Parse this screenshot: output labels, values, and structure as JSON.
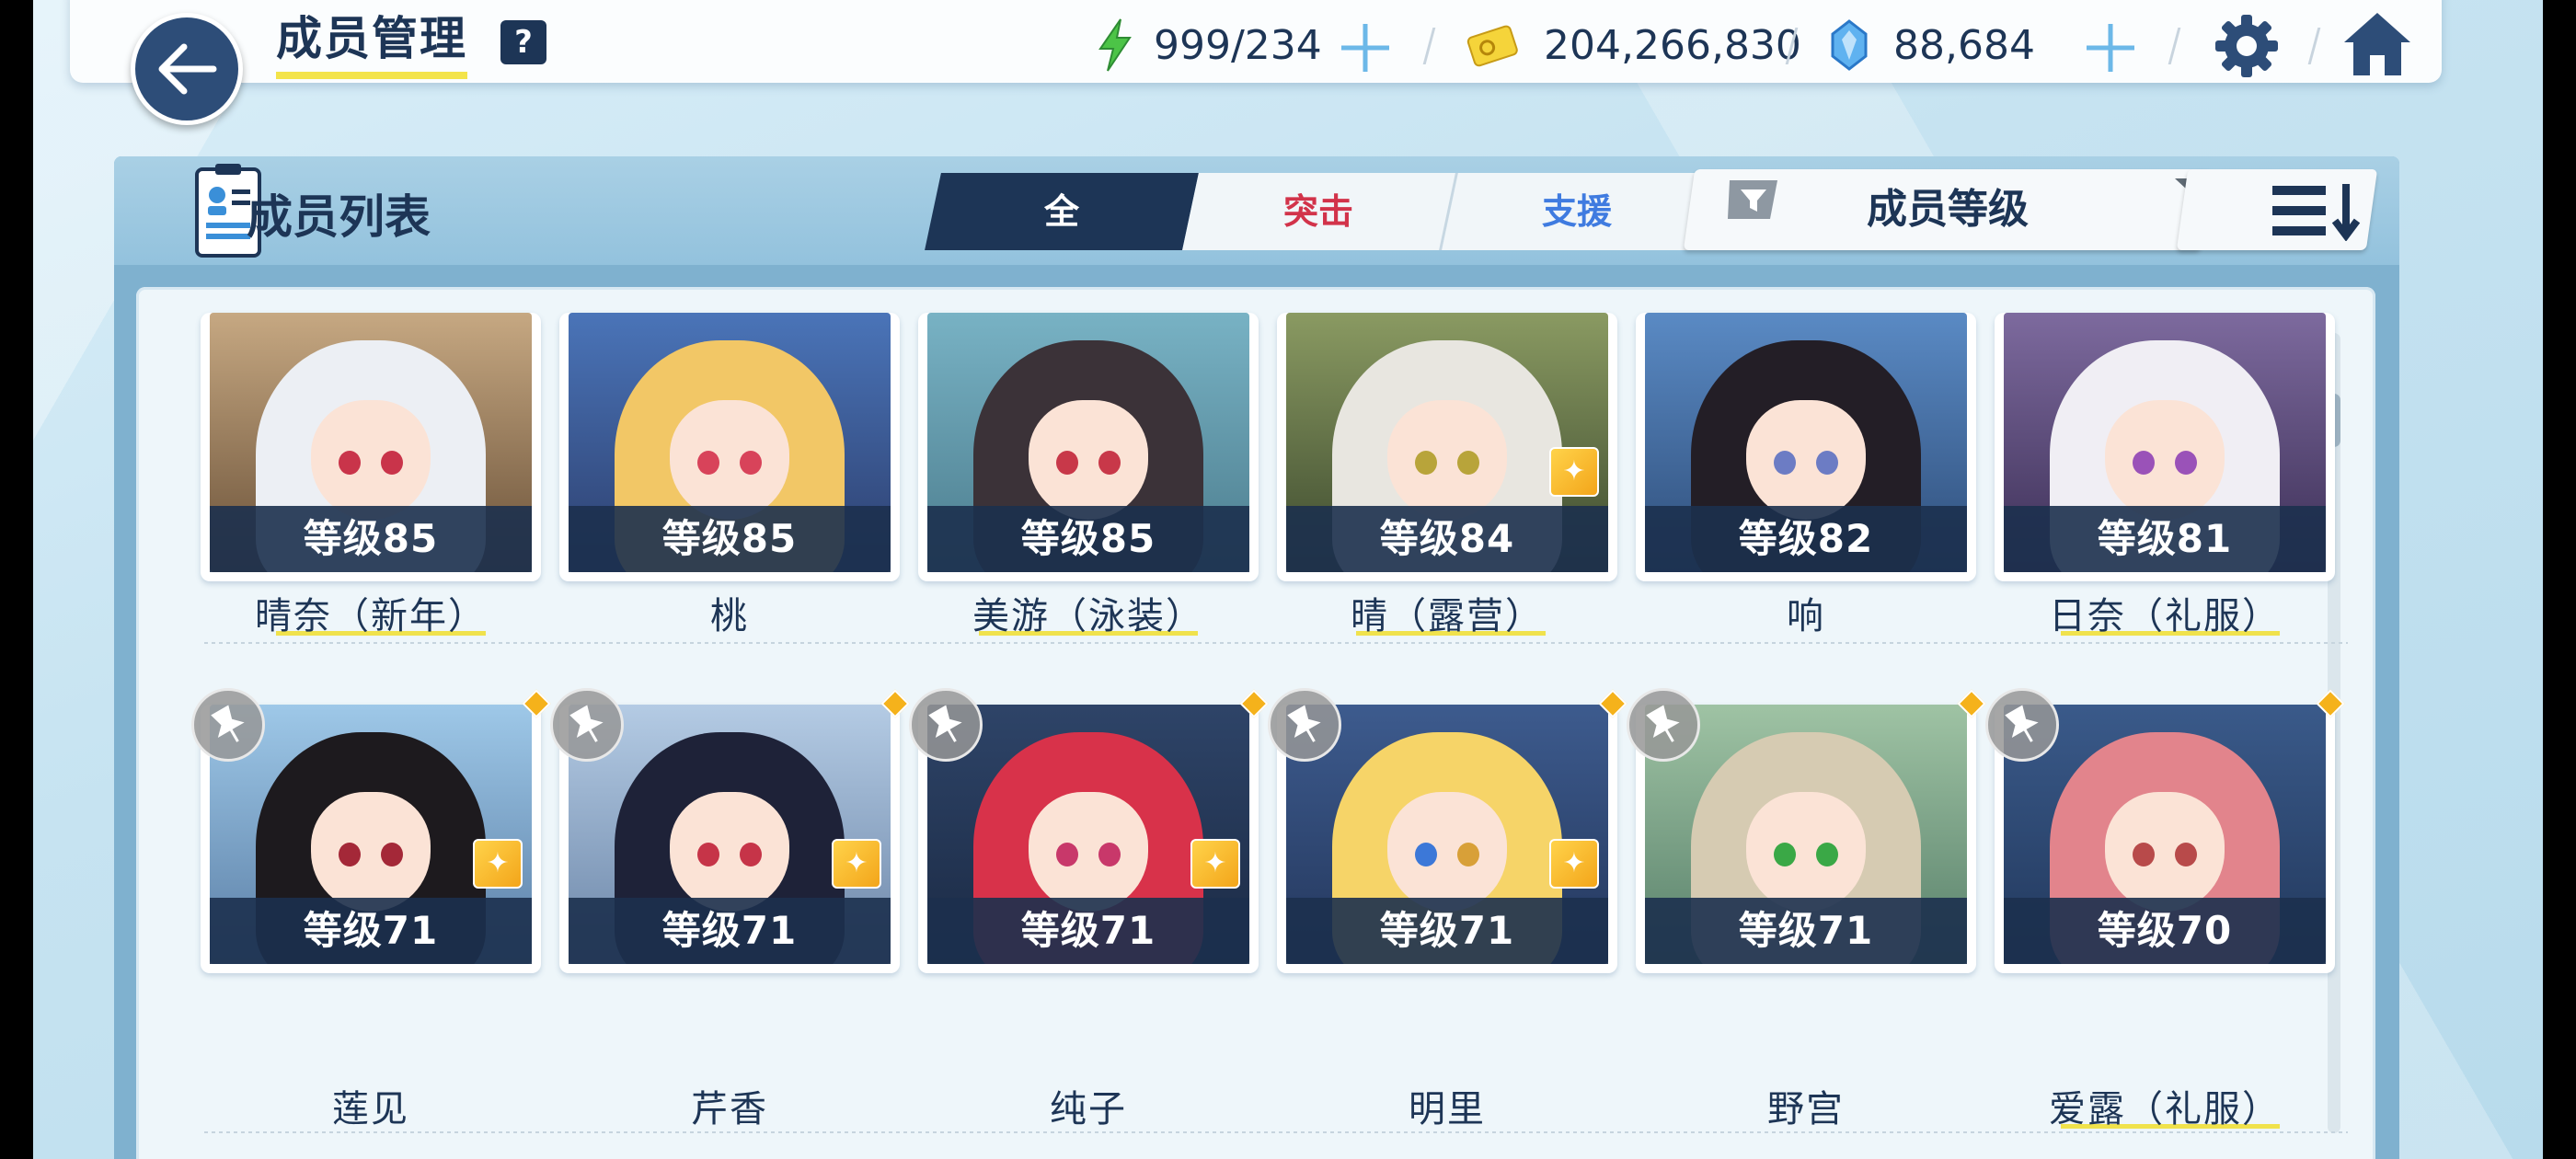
{
  "header": {
    "title": "成员管理",
    "help_label": "?",
    "ap": "999/234",
    "credits": "204,266,830",
    "gems": "88,684"
  },
  "list": {
    "title": "成员列表",
    "tabs": [
      {
        "label": "全",
        "active": true
      },
      {
        "label": "突击",
        "active": false
      },
      {
        "label": "支援",
        "active": false
      }
    ],
    "sort_label": "成员等级"
  },
  "members": [
    {
      "level": "等级85",
      "name": "晴奈（新年）"
    },
    {
      "level": "等级85",
      "name": "桃"
    },
    {
      "level": "等级85",
      "name": "美游（泳装）"
    },
    {
      "level": "等级84",
      "name": "晴（露营）"
    },
    {
      "level": "等级82",
      "name": "响"
    },
    {
      "level": "等级81",
      "name": "日奈（礼服）"
    },
    {
      "level": "等级71",
      "name": "莲见"
    },
    {
      "level": "等级71",
      "name": "芹香"
    },
    {
      "level": "等级71",
      "name": "纯子"
    },
    {
      "level": "等级71",
      "name": "明里"
    },
    {
      "level": "等级71",
      "name": "野宫"
    },
    {
      "level": "等级70",
      "name": "爱露（礼服）"
    }
  ],
  "colors": {
    "navy": "#1d3556",
    "tab_active_bg": "#1d3556",
    "striker": "#d2334a",
    "special": "#3f7be0",
    "accent_yellow": "#f3e44a"
  }
}
